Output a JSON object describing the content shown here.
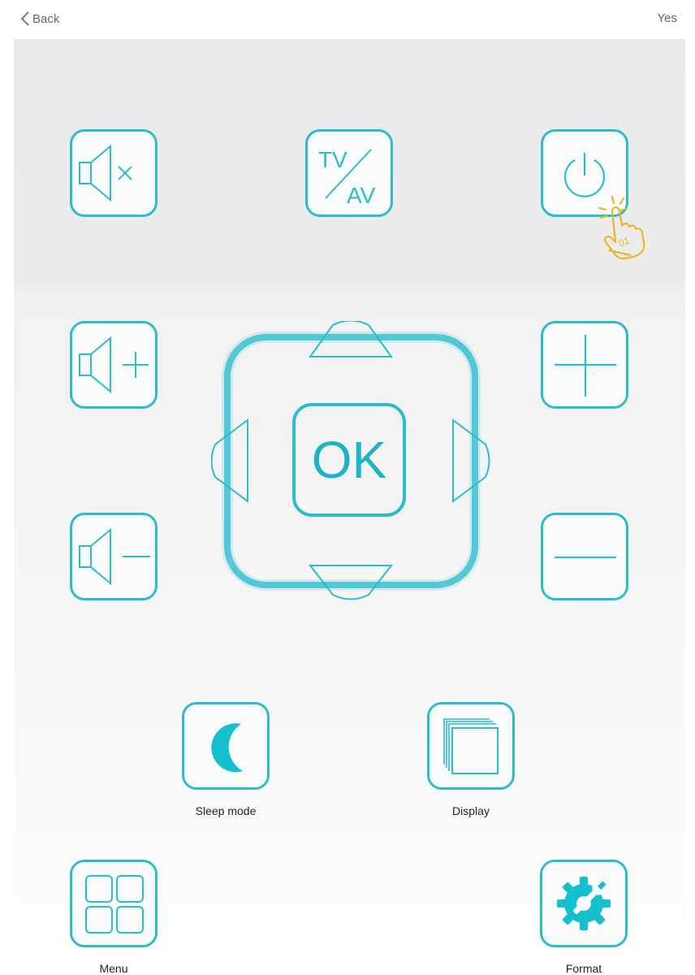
{
  "nav": {
    "back_label": "Back",
    "confirm_label": "Yes"
  },
  "buttons": {
    "mute": {
      "icon": "mute-icon"
    },
    "tvav": {
      "icon": "tv-av-icon",
      "line1": "TV",
      "line2": "AV"
    },
    "power": {
      "icon": "power-icon"
    },
    "vol_up": {
      "icon": "volume-up-icon"
    },
    "vol_down": {
      "icon": "volume-down-icon"
    },
    "ch_up": {
      "icon": "plus-icon"
    },
    "ch_down": {
      "icon": "minus-icon"
    },
    "ok": {
      "label": "OK"
    },
    "sleep": {
      "icon": "moon-icon",
      "label": "Sleep mode"
    },
    "display": {
      "icon": "display-layers-icon",
      "label": "Display"
    },
    "menu": {
      "icon": "grid-icon",
      "label": "Menu"
    },
    "format": {
      "icon": "gear-wrench-icon",
      "label": "Format"
    }
  },
  "hint": {
    "icon": "tap-hand-icon",
    "text": "01"
  },
  "colors": {
    "accent": "#2bbccd",
    "hint": "#e8b828",
    "background": "#ececec"
  }
}
